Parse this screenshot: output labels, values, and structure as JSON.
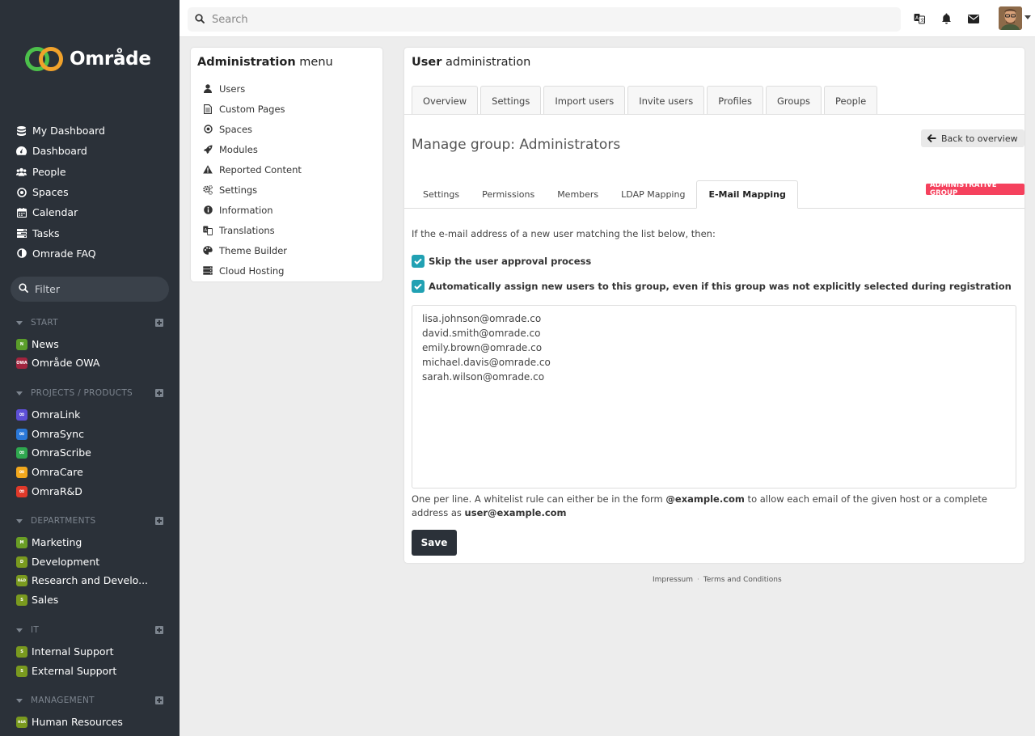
{
  "brand": {
    "name": "Område"
  },
  "search": {
    "placeholder": "Search"
  },
  "nav": {
    "items": [
      {
        "label": "My Dashboard",
        "icon": "database-icon"
      },
      {
        "label": "Dashboard",
        "icon": "dashboard-icon"
      },
      {
        "label": "People",
        "icon": "users-icon"
      },
      {
        "label": "Spaces",
        "icon": "dot-circle-icon"
      },
      {
        "label": "Calendar",
        "icon": "calendar-icon"
      },
      {
        "label": "Tasks",
        "icon": "tasks-icon"
      },
      {
        "label": "Omrade FAQ",
        "icon": "half-circle-icon"
      }
    ]
  },
  "filter": {
    "placeholder": "Filter"
  },
  "sections": [
    {
      "title": "START",
      "items": [
        {
          "label": "News",
          "badge": "N",
          "color": "#5a9d2a"
        },
        {
          "label": "Område OWA",
          "badge": "OWA",
          "color": "#a1243e"
        }
      ]
    },
    {
      "title": "PROJECTS / PRODUCTS",
      "items": [
        {
          "label": "OmraLink",
          "badge": "∞",
          "color": "#5d4fd6"
        },
        {
          "label": "OmraSync",
          "badge": "∞",
          "color": "#2a78d9"
        },
        {
          "label": "OmraScribe",
          "badge": "∞",
          "color": "#2fa84f"
        },
        {
          "label": "OmraCare",
          "badge": "∞",
          "color": "#f2a81d"
        },
        {
          "label": "OmraR&D",
          "badge": "∞",
          "color": "#e0392a"
        }
      ]
    },
    {
      "title": "DEPARTMENTS",
      "items": [
        {
          "label": "Marketing",
          "badge": "M",
          "color": "#6a9e25"
        },
        {
          "label": "Development",
          "badge": "D",
          "color": "#7a9a1f"
        },
        {
          "label": "Research and Develo...",
          "badge": "R&D",
          "color": "#7a9a1f"
        },
        {
          "label": "Sales",
          "badge": "S",
          "color": "#7a9a1f"
        }
      ]
    },
    {
      "title": "IT",
      "items": [
        {
          "label": "Internal Support",
          "badge": "S",
          "color": "#7a9a1f"
        },
        {
          "label": "External Support",
          "badge": "S",
          "color": "#7a9a1f"
        }
      ]
    },
    {
      "title": "MANAGEMENT",
      "items": [
        {
          "label": "Human Resources",
          "badge": "H&R",
          "color": "#7a9a1f"
        }
      ]
    }
  ],
  "admin_menu": {
    "title_bold": "Administration",
    "title_rest": " menu",
    "items": [
      {
        "label": "Users",
        "icon": "user-icon"
      },
      {
        "label": "Custom Pages",
        "icon": "page-icon"
      },
      {
        "label": "Spaces",
        "icon": "dot-circle-icon"
      },
      {
        "label": "Modules",
        "icon": "rocket-icon"
      },
      {
        "label": "Reported Content",
        "icon": "warning-icon"
      },
      {
        "label": "Settings",
        "icon": "cogs-icon"
      },
      {
        "label": "Information",
        "icon": "info-icon"
      },
      {
        "label": "Translations",
        "icon": "language-icon"
      },
      {
        "label": "Theme Builder",
        "icon": "palette-icon"
      },
      {
        "label": "Cloud Hosting",
        "icon": "server-icon"
      }
    ]
  },
  "main": {
    "title_bold": "User",
    "title_rest": " administration",
    "tabs": [
      "Overview",
      "Settings",
      "Import users",
      "Invite users",
      "Profiles",
      "Groups",
      "People"
    ],
    "manage_title": "Manage group: Administrators",
    "back_label": "Back to overview",
    "subtabs": [
      "Settings",
      "Permissions",
      "Members",
      "LDAP Mapping",
      "E-Mail Mapping"
    ],
    "active_subtab": "E-Mail Mapping",
    "badge": "ADMINISTRATIVE GROUP",
    "intro": "If the e-mail address of a new user matching the list below, then:",
    "check1": "Skip the user approval process",
    "check2": "Automatically assign new users to this group, even if this group was not explicitly selected during registration",
    "emails": [
      "lisa.johnson@omrade.co",
      "david.smith@omrade.co",
      "emily.brown@omrade.co",
      "michael.davis@omrade.co",
      "sarah.wilson@omrade.co"
    ],
    "help_1": "One per line. A whitelist rule can either be in the form ",
    "help_b1": "@example.com",
    "help_2": " to allow each email of the given host or a complete address as ",
    "help_b2": "user@example.com",
    "save_label": "Save"
  },
  "footer": {
    "impressum": "Impressum",
    "terms": "Terms and Conditions"
  }
}
